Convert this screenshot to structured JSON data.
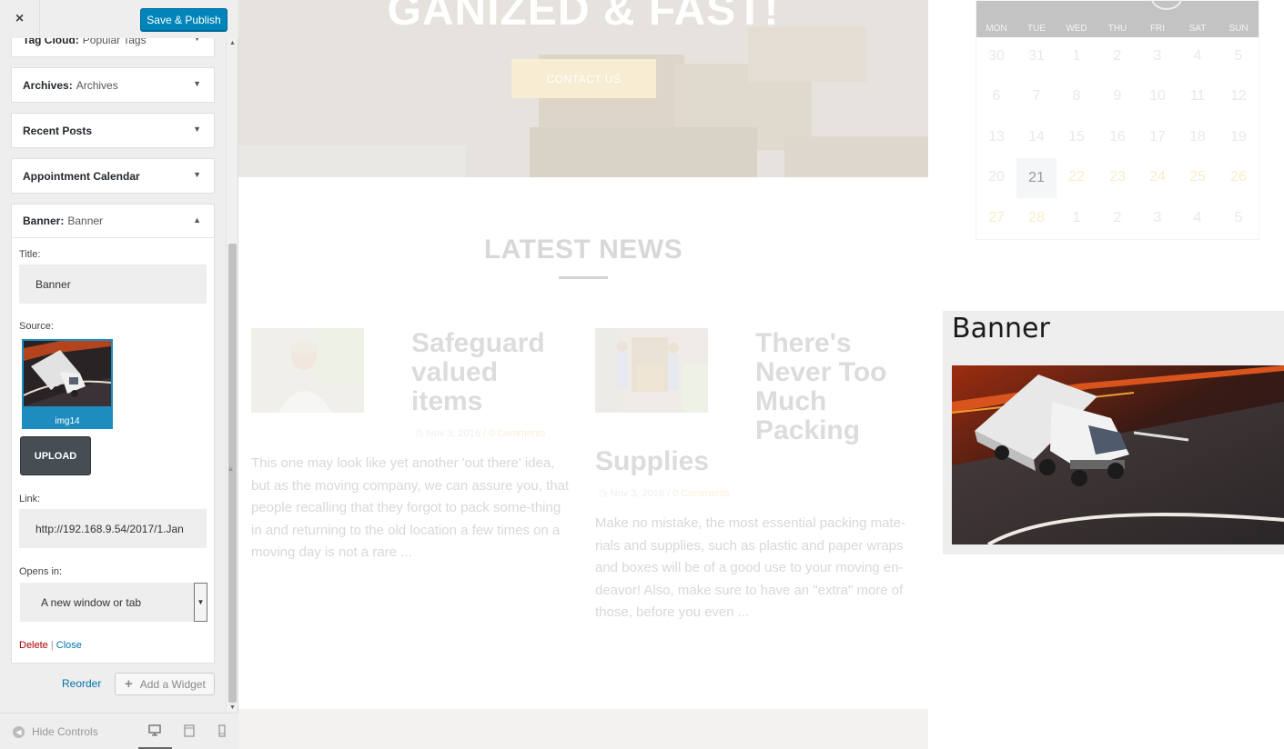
{
  "sidebar": {
    "close_icon": "×",
    "publish_label": "Save & Publish",
    "widgets": [
      {
        "type": "Tag Cloud:",
        "title": "Popular Tags"
      },
      {
        "type": "Archives:",
        "title": "Archives"
      },
      {
        "type": "Recent Posts",
        "title": ""
      },
      {
        "type": "Appointment Calendar",
        "title": ""
      },
      {
        "type": "Banner:",
        "title": "Banner"
      }
    ],
    "banner_form": {
      "title_label": "Title:",
      "title_value": "Banner",
      "source_label": "Source:",
      "source_caption": "img14",
      "upload_label": "UPLOAD",
      "link_label": "Link:",
      "link_value": "http://192.168.9.54/2017/1.Jan",
      "opens_label": "Opens in:",
      "opens_value": "A new window or tab",
      "delete_label": "Delete",
      "separator": "|",
      "close_label": "Close"
    },
    "reorder_label": "Reorder",
    "add_widget_label": "Add a Widget",
    "hide_controls_label": "Hide Controls"
  },
  "preview": {
    "hero_heading": "GANIZED & FAST!",
    "contact_label": "CONTACT US",
    "news_title": "LATEST NEWS",
    "posts": [
      {
        "title": "Safeguard valued items",
        "date": "Nov 3, 2016",
        "comments": "0 Comments",
        "excerpt": "This one may look like yet another 'out there' idea, but as the moving company, we can assure you, that people recalling that they forgot to pack some-thing in and returning to the old location a few times on a moving day is not a rare ..."
      },
      {
        "title": "There's Never Too Much Packing",
        "title_cont": "Supplies",
        "date": "Nov 3, 2016",
        "comments": "0 Comments",
        "excerpt": "Make no mistake, the most essential packing mate-rials and supplies, such as plastic and paper wraps and boxes will be of a good use to your moving en-deavor! Also, make sure to have an \"extra\" more of those, before you even ..."
      }
    ],
    "calendar": {
      "weekdays": [
        "MON",
        "TUE",
        "WED",
        "THU",
        "FRI",
        "SAT",
        "SUN"
      ],
      "weeks": [
        [
          "30",
          "31",
          "1",
          "2",
          "3",
          "4",
          "5"
        ],
        [
          "6",
          "7",
          "8",
          "9",
          "10",
          "11",
          "12"
        ],
        [
          "13",
          "14",
          "15",
          "16",
          "17",
          "18",
          "19"
        ],
        [
          "20",
          "21",
          "22",
          "23",
          "24",
          "25",
          "26"
        ],
        [
          "27",
          "28",
          "1",
          "2",
          "3",
          "4",
          "5"
        ]
      ],
      "today": "21"
    },
    "banner_title": "Banner"
  },
  "colors": {
    "publish": "#0085ba",
    "upload": "#464e54",
    "link": "#0073aa",
    "delete": "#aa0000",
    "accent_day": "#faedc9"
  }
}
